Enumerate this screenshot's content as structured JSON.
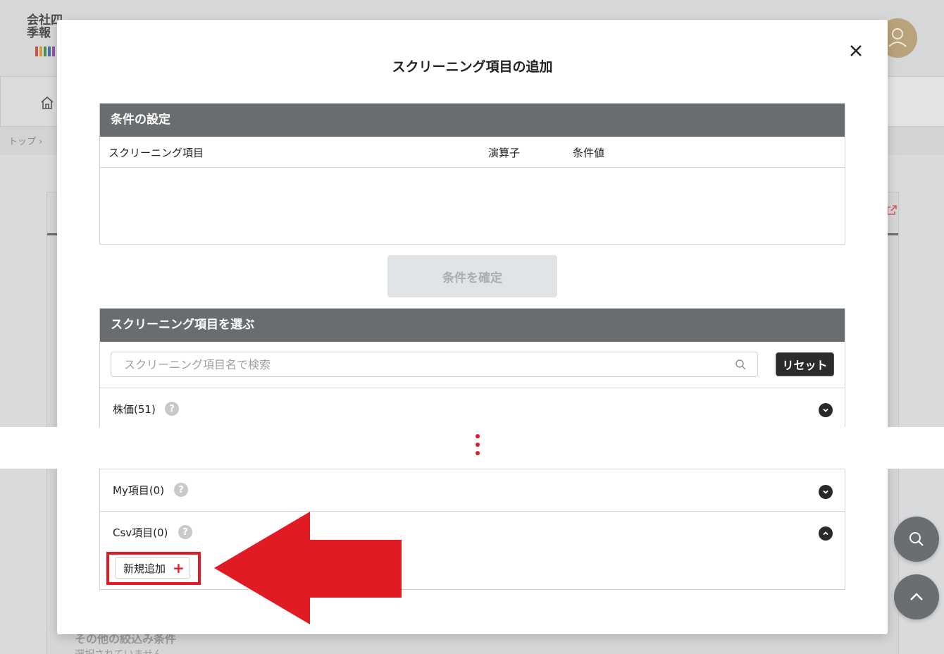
{
  "background": {
    "logo_text": "会社四季報",
    "breadcrumb": "トップ ›",
    "bottom_heading": "その他の絞込み条件",
    "bottom_sub": "選択されていません"
  },
  "modal": {
    "title": "スクリーニング項目の追加",
    "close_icon": "close-icon"
  },
  "conditions": {
    "header": "条件の設定",
    "columns": [
      "スクリーニング項目",
      "演算子",
      "条件値"
    ],
    "confirm_label": "条件を確定"
  },
  "selector": {
    "header": "スクリーニング項目を選ぶ",
    "search_placeholder": "スクリーニング項目名で検索",
    "reset_label": "リセット",
    "categories": [
      {
        "label": "株価(51)",
        "expanded": false
      },
      {
        "label": "My項目(0)",
        "expanded": false
      },
      {
        "label": "Csv項目(0)",
        "expanded": true
      }
    ],
    "help_glyph": "?",
    "new_button_label": "新規追加",
    "new_button_icon": "+"
  },
  "annotation": {
    "color": "#e01b24"
  },
  "colors": {
    "panel_header": "#6a6d70",
    "accent_red": "#e01b24",
    "float_button": "#6a6e72"
  }
}
